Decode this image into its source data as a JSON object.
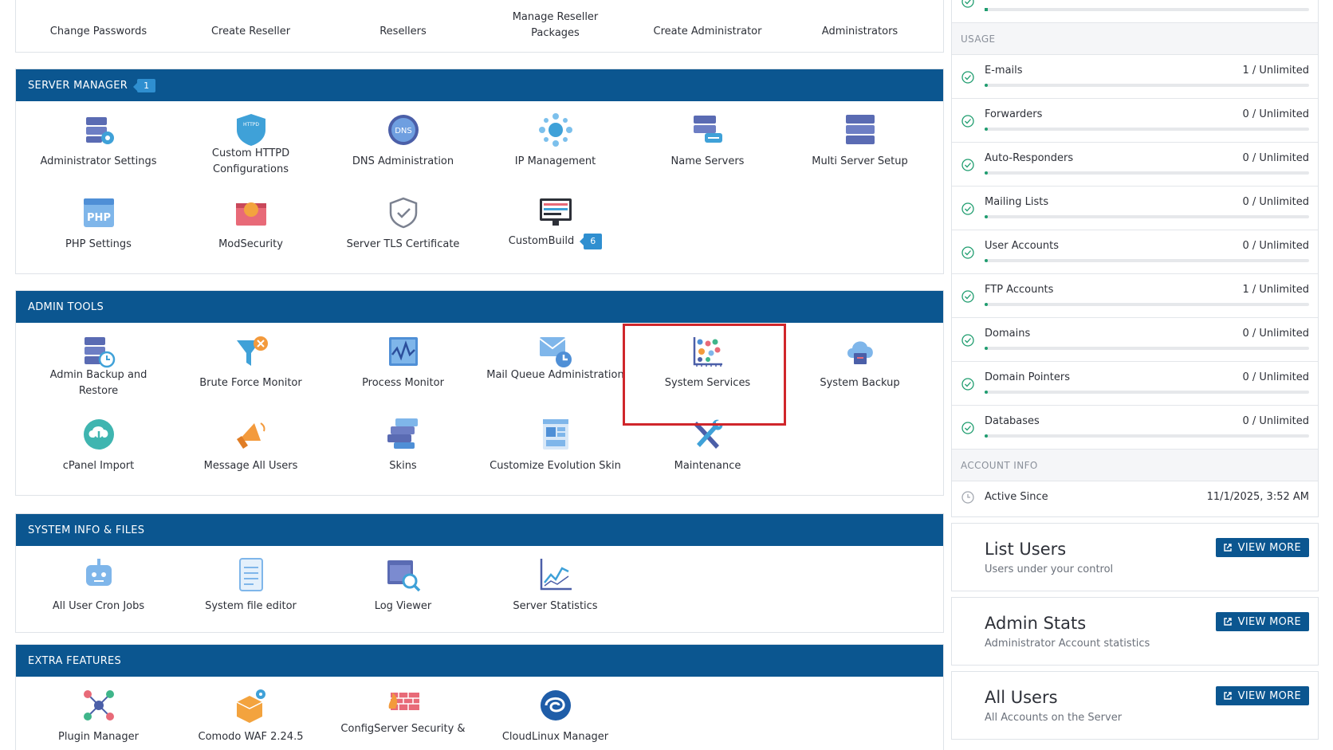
{
  "top_row": {
    "items": [
      {
        "label": "Change Passwords",
        "icon": "key-icon"
      },
      {
        "label": "Create Reseller",
        "icon": "create-reseller-icon"
      },
      {
        "label": "Resellers",
        "icon": "resellers-icon"
      },
      {
        "label": "Manage Reseller Packages",
        "icon": "package-icon"
      },
      {
        "label": "Create Administrator",
        "icon": "create-admin-icon"
      },
      {
        "label": "Administrators",
        "icon": "administrators-icon"
      }
    ]
  },
  "server_manager": {
    "title": "SERVER MANAGER",
    "badge": "1",
    "items": [
      {
        "label": "Administrator Settings"
      },
      {
        "label": "Custom HTTPD Configurations"
      },
      {
        "label": "DNS Administration"
      },
      {
        "label": "IP Management"
      },
      {
        "label": "Name Servers"
      },
      {
        "label": "Multi Server Setup"
      },
      {
        "label": "PHP Settings"
      },
      {
        "label": "ModSecurity"
      },
      {
        "label": "Server TLS Certificate"
      },
      {
        "label": "CustomBuild",
        "badge": "6"
      }
    ]
  },
  "admin_tools": {
    "title": "ADMIN TOOLS",
    "items": [
      {
        "label": "Admin Backup and Restore"
      },
      {
        "label": "Brute Force Monitor"
      },
      {
        "label": "Process Monitor"
      },
      {
        "label": "Mail Queue Administration"
      },
      {
        "label": "System Services"
      },
      {
        "label": "System Backup"
      },
      {
        "label": "cPanel Import"
      },
      {
        "label": "Message All Users"
      },
      {
        "label": "Skins"
      },
      {
        "label": "Customize Evolution Skin"
      },
      {
        "label": "Maintenance"
      }
    ]
  },
  "system_info": {
    "title": "SYSTEM INFO & FILES",
    "items": [
      {
        "label": "All User Cron Jobs"
      },
      {
        "label": "System file editor"
      },
      {
        "label": "Log Viewer"
      },
      {
        "label": "Server Statistics"
      }
    ]
  },
  "extra_features": {
    "title": "EXTRA FEATURES",
    "items": [
      {
        "label": "Plugin Manager"
      },
      {
        "label": "Comodo WAF 2.24.5"
      },
      {
        "label": "ConfigServer Security &"
      },
      {
        "label": "CloudLinux Manager"
      }
    ]
  },
  "usage": {
    "title": "USAGE",
    "rows": [
      {
        "name": "E-mails",
        "value": "1 / Unlimited"
      },
      {
        "name": "Forwarders",
        "value": "0 / Unlimited"
      },
      {
        "name": "Auto-Responders",
        "value": "0 / Unlimited"
      },
      {
        "name": "Mailing Lists",
        "value": "0 / Unlimited"
      },
      {
        "name": "User Accounts",
        "value": "0 / Unlimited"
      },
      {
        "name": "FTP Accounts",
        "value": "1 / Unlimited"
      },
      {
        "name": "Domains",
        "value": "0 / Unlimited"
      },
      {
        "name": "Domain Pointers",
        "value": "0 / Unlimited"
      },
      {
        "name": "Databases",
        "value": "0 / Unlimited"
      }
    ]
  },
  "account_info": {
    "title": "ACCOUNT INFO",
    "active_since_label": "Active Since",
    "active_since_value": "11/1/2025, 3:52 AM"
  },
  "cards": [
    {
      "title": "List Users",
      "subtitle": "Users under your control",
      "button": "VIEW MORE"
    },
    {
      "title": "Admin Stats",
      "subtitle": "Administrator Account statistics",
      "button": "VIEW MORE"
    },
    {
      "title": "All Users",
      "subtitle": "All Accounts on the Server",
      "button": "VIEW MORE"
    }
  ],
  "colors": {
    "header": "#0b5690",
    "badge": "#2f8fd0",
    "highlight": "#d0262b",
    "progress": "#1f9d6f"
  }
}
